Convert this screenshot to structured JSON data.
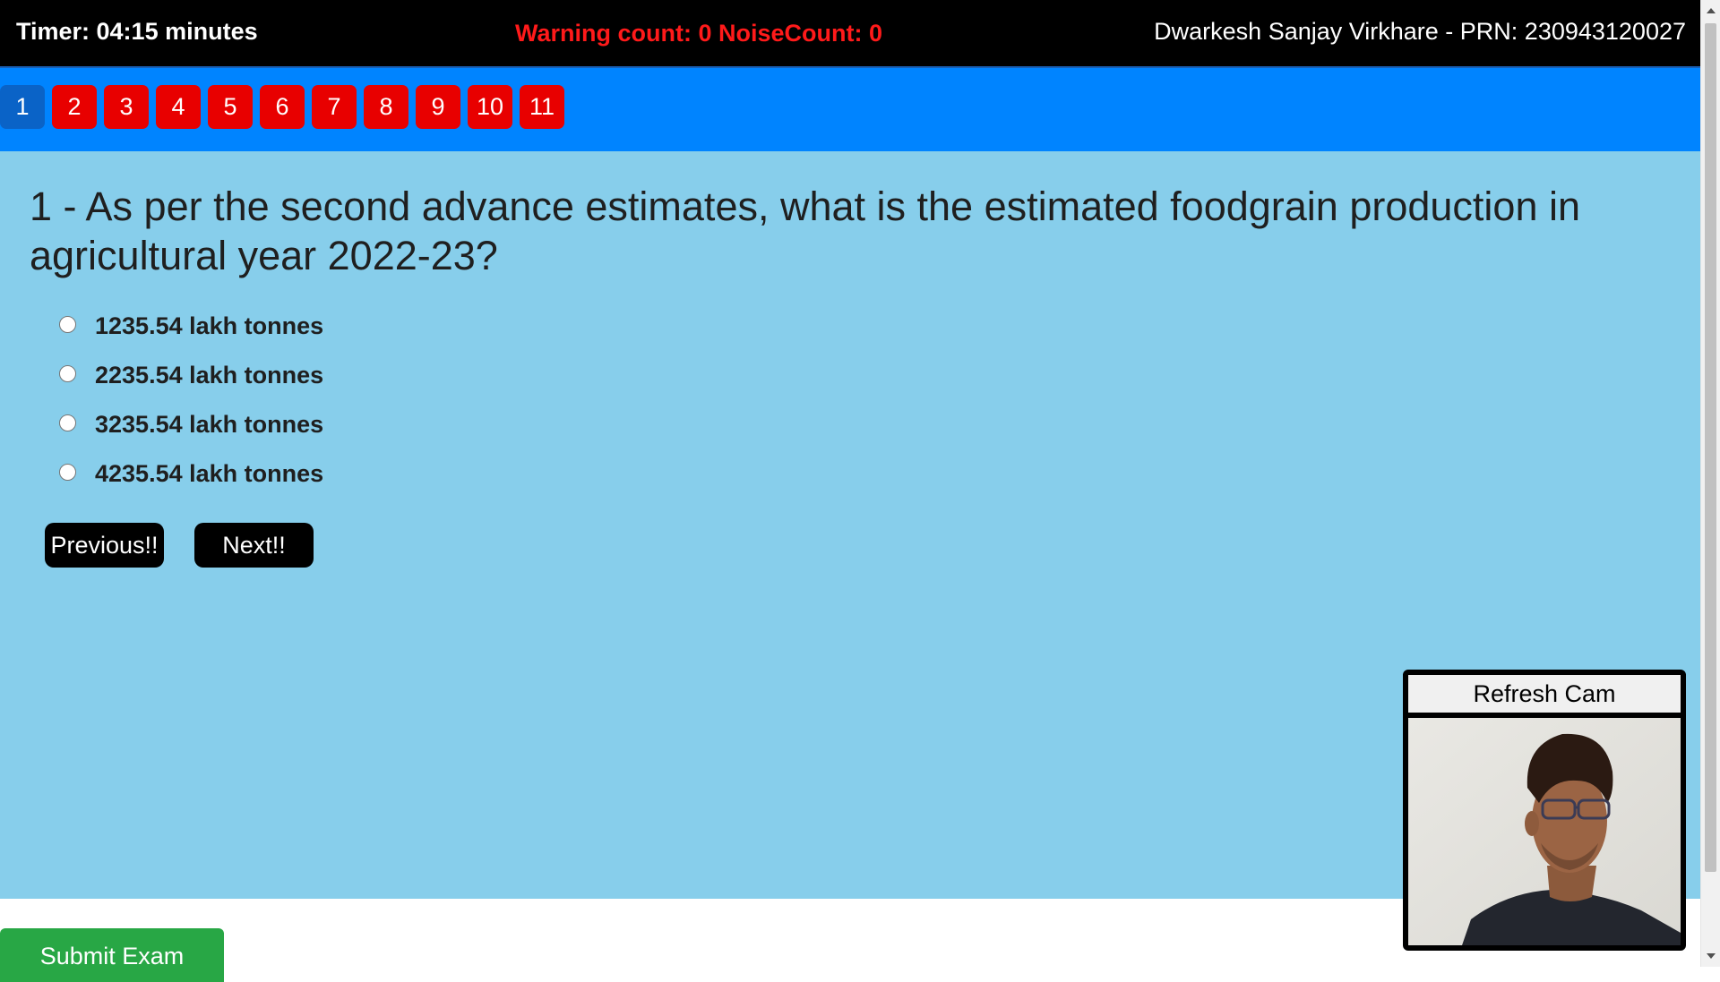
{
  "header": {
    "timer": "Timer: 04:15 minutes",
    "warning": "Warning count: 0 NoiseCount: 0",
    "user": "Dwarkesh Sanjay Virkhare - PRN: 230943120027"
  },
  "question_nav": {
    "items": [
      "1",
      "2",
      "3",
      "4",
      "5",
      "6",
      "7",
      "8",
      "9",
      "10",
      "11"
    ],
    "active": "1"
  },
  "question": {
    "text": "1 - As per the second advance estimates, what is the estimated foodgrain production in agricultural year 2022-23?",
    "options": [
      "1235.54 lakh tonnes",
      "2235.54 lakh tonnes",
      "3235.54 lakh tonnes",
      "4235.54 lakh tonnes"
    ]
  },
  "buttons": {
    "previous": "Previous!!",
    "next": "Next!!",
    "submit": "Submit Exam",
    "refresh_cam": "Refresh Cam"
  },
  "colors": {
    "topbar": "#000000",
    "warning": "#ff1a1a",
    "nav_strip": "#0084ff",
    "question_unanswered": "#e80000",
    "question_active": "#0a63c7",
    "main_bg": "#87ceeb",
    "submit": "#28a745"
  }
}
